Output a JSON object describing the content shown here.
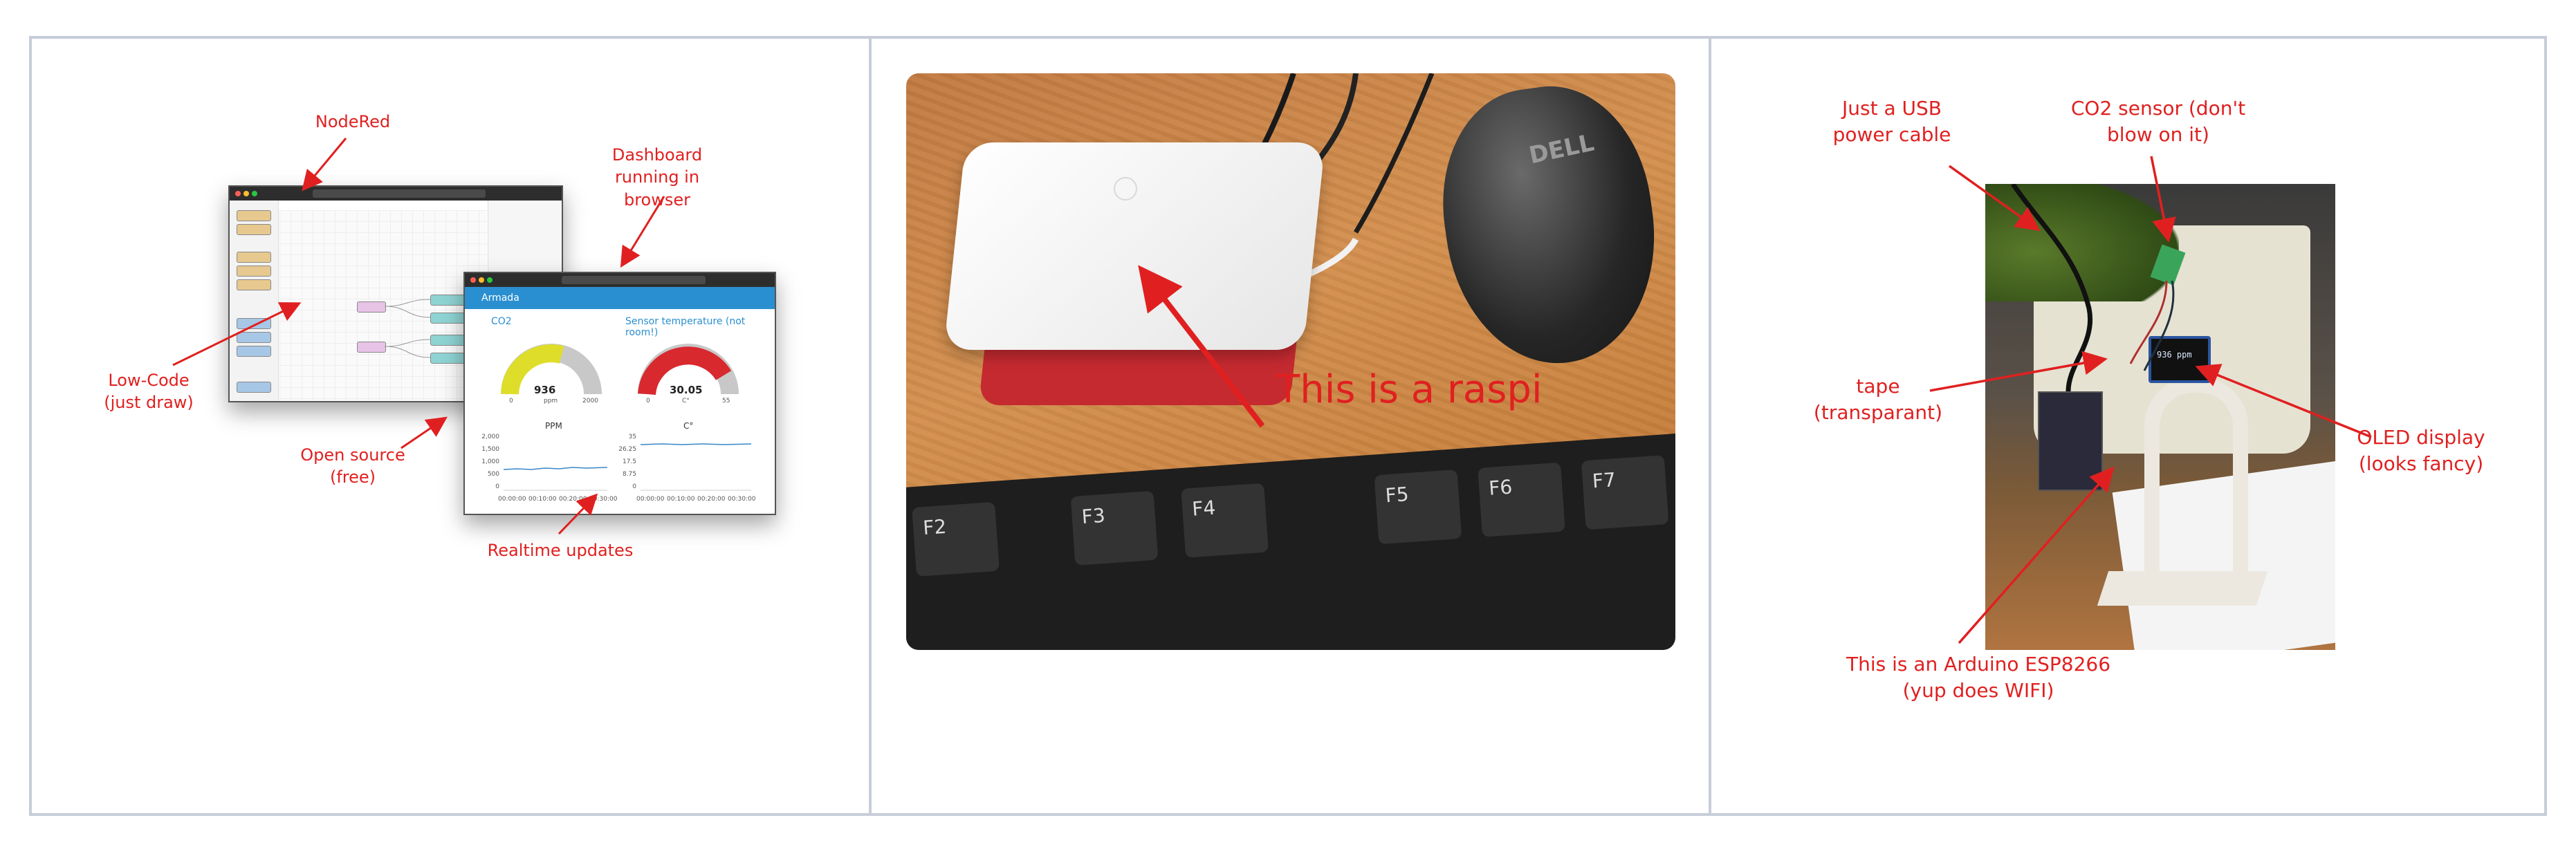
{
  "panel1": {
    "labels": {
      "nodered": "NodeRed",
      "dashboard": "Dashboard running in browser",
      "lowcode": "Low-Code (just draw)",
      "opensource": "Open source (free)",
      "realtime": "Realtime updates"
    },
    "dashboard": {
      "header": "Armada",
      "gauge1_label": "CO2",
      "gauge1_value": "936",
      "gauge1_unit": "ppm",
      "gauge1_min": "0",
      "gauge1_max": "2000",
      "gauge2_label": "Sensor temperature (not room!)",
      "gauge2_value": "30.05",
      "gauge2_unit": "C°",
      "gauge2_min": "0",
      "gauge2_max": "55",
      "chart1_title": "PPM",
      "chart2_title": "C°",
      "chart1_yticks": [
        "2,000",
        "1,500",
        "1,000",
        "500",
        "0"
      ],
      "chart2_yticks": [
        "35",
        "26.25",
        "17.5",
        "8.75",
        "0"
      ],
      "xticks": [
        "00:00:00",
        "00:10:00",
        "00:20:00",
        "00:30:00"
      ]
    }
  },
  "panel2": {
    "caption": "This is a raspi",
    "keys": [
      "F2",
      "F3",
      "F4",
      "F5",
      "F6",
      "F7"
    ],
    "mouse_brand": "DELL"
  },
  "panel3": {
    "labels": {
      "usb": "Just a USB power cable",
      "co2": "CO2 sensor (don't blow on it)",
      "tape": "tape (transparant)",
      "oled": "OLED display (looks fancy)",
      "arduino": "This is an Arduino ESP8266 (yup does WIFI)"
    },
    "oled_text": "936 ppm"
  },
  "colors": {
    "annotation": "#e02020",
    "frame": "#c7cdd8",
    "dashboard_blue": "#2a8fd0",
    "gauge_yellow": "#dede2a",
    "gauge_red": "#d8292f"
  }
}
